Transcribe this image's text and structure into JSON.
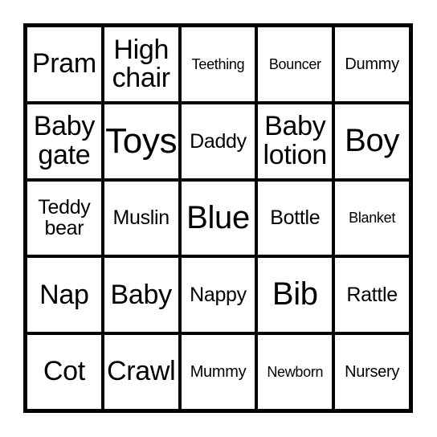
{
  "card": {
    "type": "bingo-card",
    "theme": "baby shower",
    "rows": 5,
    "columns": 5,
    "background_color": "#ffffff",
    "border_color": "#000000",
    "text_color": "#000000",
    "cells": [
      [
        {
          "text": "Pram",
          "size": "md",
          "lines": 1
        },
        {
          "text": "High\nchair",
          "size": "md",
          "lines": 2
        },
        {
          "text": "Teething",
          "size": "xxs",
          "lines": 1
        },
        {
          "text": "Bouncer",
          "size": "xxs",
          "lines": 1
        },
        {
          "text": "Dummy",
          "size": "xs",
          "lines": 1
        }
      ],
      [
        {
          "text": "Baby\ngate",
          "size": "md",
          "lines": 2
        },
        {
          "text": "Toys",
          "size": "xl",
          "lines": 1
        },
        {
          "text": "Daddy",
          "size": "sm",
          "lines": 1
        },
        {
          "text": "Baby\nlotion",
          "size": "md",
          "lines": 2
        },
        {
          "text": "Boy",
          "size": "lg",
          "lines": 1
        }
      ],
      [
        {
          "text": "Teddy\nbear",
          "size": "sm",
          "lines": 2
        },
        {
          "text": "Muslin",
          "size": "sm",
          "lines": 1
        },
        {
          "text": "Blue",
          "size": "lg",
          "lines": 1
        },
        {
          "text": "Bottle",
          "size": "sm",
          "lines": 1
        },
        {
          "text": "Blanket",
          "size": "xxs",
          "lines": 1
        }
      ],
      [
        {
          "text": "Nap",
          "size": "md",
          "lines": 1
        },
        {
          "text": "Baby",
          "size": "md",
          "lines": 1
        },
        {
          "text": "Nappy",
          "size": "sm",
          "lines": 1
        },
        {
          "text": "Bib",
          "size": "lg",
          "lines": 1
        },
        {
          "text": "Rattle",
          "size": "sm",
          "lines": 1
        }
      ],
      [
        {
          "text": "Cot",
          "size": "md",
          "lines": 1
        },
        {
          "text": "Crawl",
          "size": "md",
          "lines": 1
        },
        {
          "text": "Mummy",
          "size": "xs",
          "lines": 1
        },
        {
          "text": "Newborn",
          "size": "xxs",
          "lines": 1
        },
        {
          "text": "Nursery",
          "size": "xs",
          "lines": 1
        }
      ]
    ]
  }
}
